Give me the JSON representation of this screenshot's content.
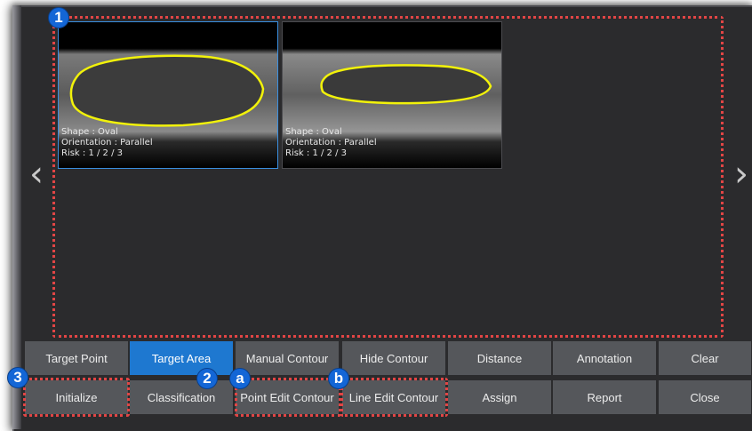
{
  "colors": {
    "accent": "#1e78d0",
    "highlight": "#e24545",
    "badge": "#1366d6",
    "contour": "#f2f20a"
  },
  "navigation": {
    "prev_icon": "chevron-left-icon",
    "next_icon": "chevron-right-icon"
  },
  "thumbnails": [
    {
      "shape": "Shape : Oval",
      "orientation": "Orientation : Parallel",
      "risk": "Risk : 1 / 2 / 3",
      "selected": true
    },
    {
      "shape": "Shape : Oval",
      "orientation": "Orientation : Parallel",
      "risk": "Risk : 1 / 2 / 3",
      "selected": false
    }
  ],
  "buttons": {
    "row1": [
      "Target Point",
      "Target Area",
      "Manual Contour",
      "Hide Contour",
      "Distance",
      "Annotation",
      "Clear"
    ],
    "row2": [
      "Initialize",
      "Classification",
      "Point Edit Contour",
      "Line Edit Contour",
      "Assign",
      "Report",
      "Close"
    ],
    "active": "Target Area"
  },
  "callouts": [
    "1",
    "2",
    "3",
    "a",
    "b"
  ]
}
